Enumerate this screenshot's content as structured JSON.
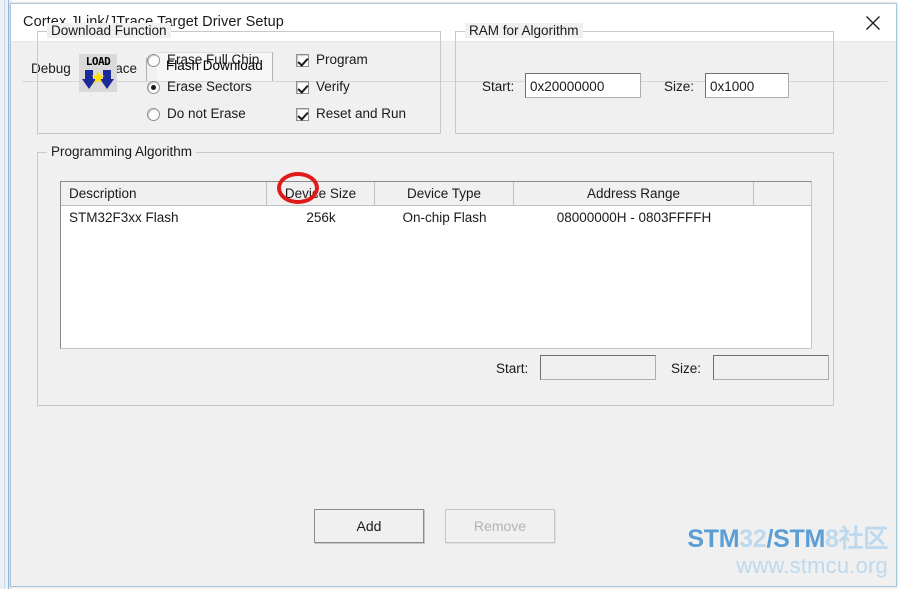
{
  "window": {
    "title": "Cortex JLink/JTrace Target Driver Setup",
    "close_icon": "close-icon"
  },
  "tabs": [
    {
      "label": "Debug",
      "active": false
    },
    {
      "label": "Trace",
      "active": false
    },
    {
      "label": "Flash Download",
      "active": true
    }
  ],
  "download_function": {
    "legend": "Download Function",
    "icon_label": "LOAD",
    "radios": [
      {
        "label": "Erase Full Chip",
        "checked": false
      },
      {
        "label": "Erase Sectors",
        "checked": true
      },
      {
        "label": "Do not Erase",
        "checked": false
      }
    ],
    "checkboxes": [
      {
        "label": "Program",
        "checked": true
      },
      {
        "label": "Verify",
        "checked": true
      },
      {
        "label": "Reset and Run",
        "checked": true,
        "annotated": true
      }
    ]
  },
  "ram_for_algorithm": {
    "legend": "RAM for Algorithm",
    "start_label": "Start:",
    "start_value": "0x20000000",
    "size_label": "Size:",
    "size_value": "0x1000"
  },
  "programming_algorithm": {
    "legend": "Programming Algorithm",
    "columns": [
      "Description",
      "Device Size",
      "Device Type",
      "Address Range",
      ""
    ],
    "rows": [
      {
        "description": "STM32F3xx Flash",
        "device_size": "256k",
        "device_type": "On-chip Flash",
        "address_range": "08000000H - 0803FFFFH"
      }
    ],
    "start_label": "Start:",
    "start_value": "",
    "size_label": "Size:",
    "size_value": ""
  },
  "buttons": {
    "add": "Add",
    "remove": "Remove"
  },
  "watermark": {
    "line1_a": "STM",
    "line1_b": "32",
    "line1_c": "/STM",
    "line1_d": "8社区",
    "line2": "www.stmcu.org",
    "accent": "#5b9ed6",
    "accent_light": "#bcd9ee"
  },
  "annotation": {
    "color": "#e01a1a",
    "shape": "ellipse-highlight"
  }
}
